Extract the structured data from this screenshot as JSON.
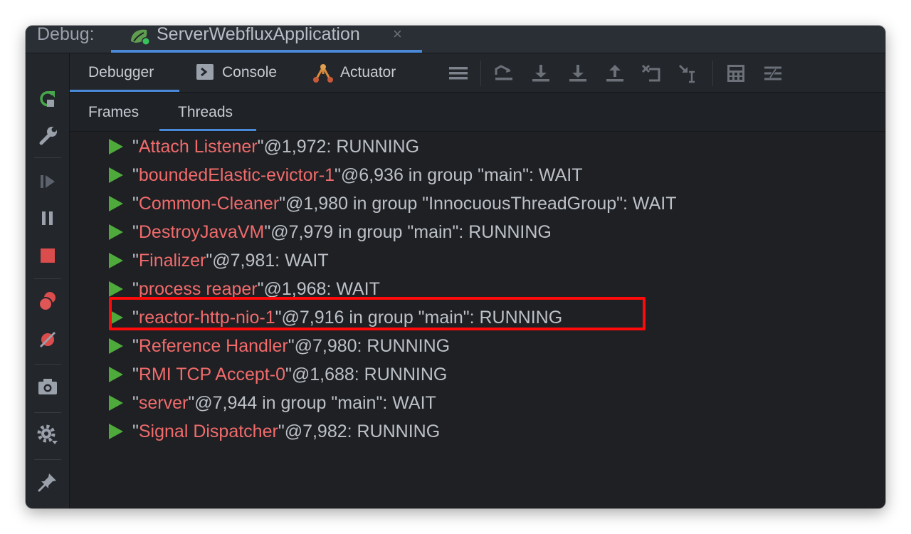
{
  "window": {
    "debug_label": "Debug:",
    "run_tab": {
      "title": "ServerWebfluxApplication",
      "close": "×"
    }
  },
  "toolbar": {
    "tabs": [
      {
        "label": "Debugger",
        "active": true
      },
      {
        "label": "Console",
        "icon": "console-icon"
      },
      {
        "label": "Actuator",
        "icon": "actuator-icon"
      }
    ],
    "icons": [
      "menu-lines-icon",
      "show-execution-point-icon",
      "step-over-icon",
      "step-into-icon",
      "step-out-icon",
      "drop-frame-icon",
      "run-to-cursor-icon",
      "evaluate-expression-icon",
      "trace-settings-icon"
    ]
  },
  "sidebar": {
    "icons": [
      "rerun-icon",
      "wrench-icon",
      "resume-icon",
      "pause-icon",
      "stop-icon",
      "view-breakpoints-icon",
      "mute-breakpoints-icon",
      "camera-icon",
      "settings-icon",
      "pin-icon"
    ]
  },
  "subtabs": [
    {
      "label": "Frames",
      "active": false
    },
    {
      "label": "Threads",
      "active": true
    }
  ],
  "threads": [
    {
      "name": "Attach Listener",
      "detail": "@1,972: RUNNING"
    },
    {
      "name": "boundedElastic-evictor-1",
      "detail": "@6,936 in group \"main\": WAIT"
    },
    {
      "name": "Common-Cleaner",
      "detail": "@1,980 in group \"InnocuousThreadGroup\": WAIT"
    },
    {
      "name": "DestroyJavaVM",
      "detail": "@7,979 in group \"main\": RUNNING"
    },
    {
      "name": "Finalizer",
      "detail": "@7,981: WAIT"
    },
    {
      "name": "process reaper",
      "detail": "@1,968: WAIT"
    },
    {
      "name": "reactor-http-nio-1",
      "detail": "@7,916 in group \"main\": RUNNING",
      "highlighted": true
    },
    {
      "name": "Reference Handler",
      "detail": "@7,980: RUNNING"
    },
    {
      "name": "RMI TCP Accept-0",
      "detail": "@1,688: RUNNING"
    },
    {
      "name": "server",
      "detail": "@7,944 in group \"main\": WAIT"
    },
    {
      "name": "Signal Dispatcher",
      "detail": "@7,982: RUNNING"
    }
  ],
  "colors": {
    "accent": "#4a88d8",
    "thread_name": "#f26b6b",
    "play_icon": "#4faa3c",
    "highlight_box": "#ff0a0a"
  }
}
